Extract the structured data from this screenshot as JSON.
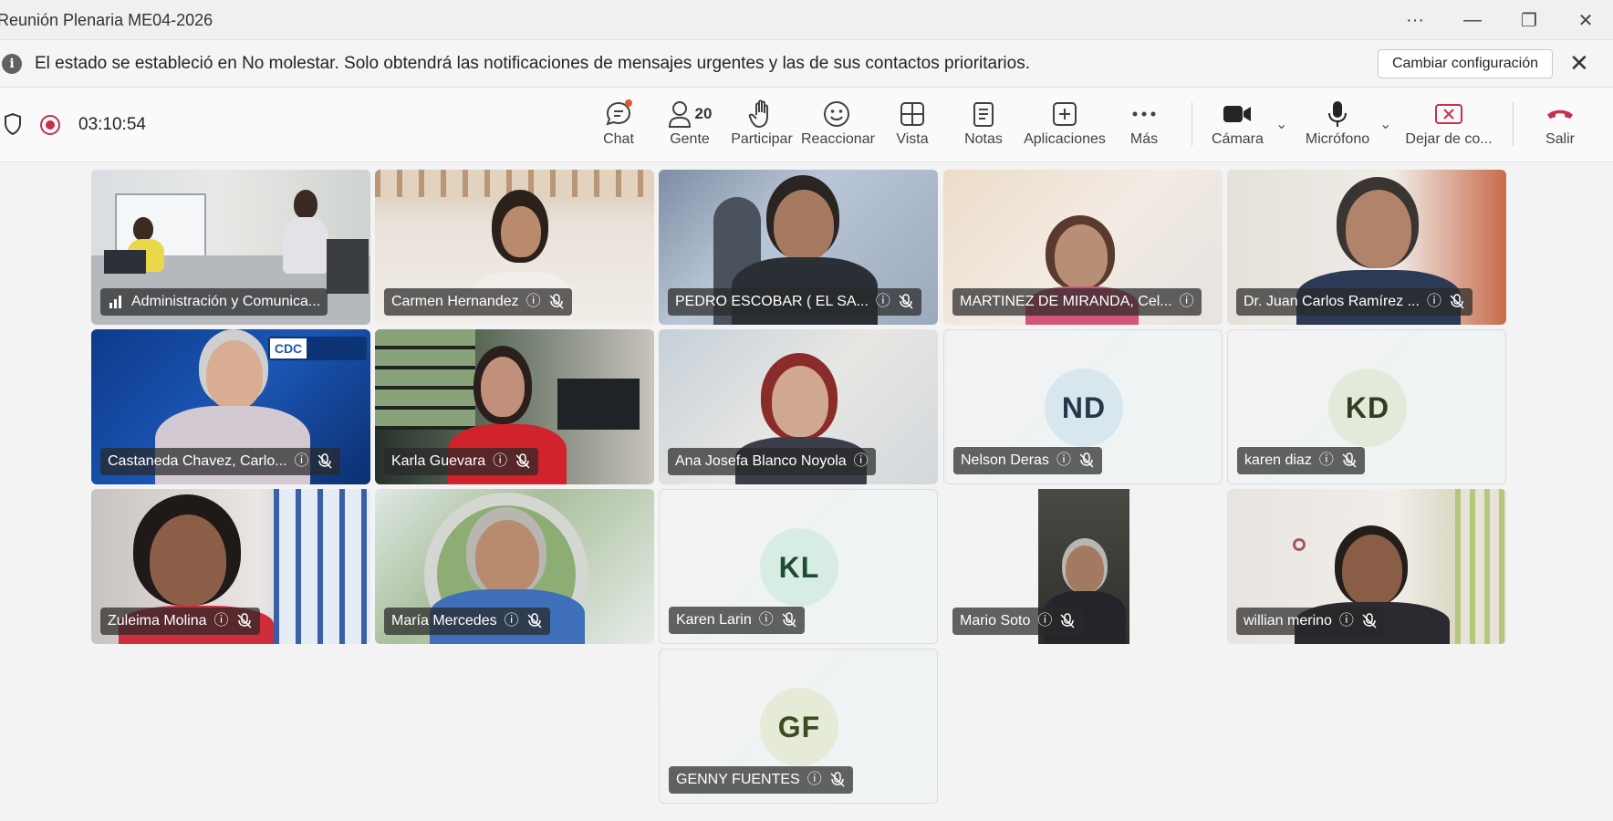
{
  "window": {
    "title": "Reunión Plenaria ME04-2026",
    "more_label": "···",
    "minimize_label": "—",
    "restore_label": "❐",
    "close_label": "✕"
  },
  "notification": {
    "message": "El estado se estableció en No molestar. Solo obtendrá las notificaciones de mensajes urgentes y las de sus contactos prioritarios.",
    "button_label": "Cambiar configuración",
    "close_label": "✕",
    "info_glyph": "i"
  },
  "toolbar": {
    "timer": "03:10:54",
    "buttons": [
      {
        "label": "Chat",
        "icon": "chat-icon"
      },
      {
        "label": "Gente",
        "icon": "people-icon",
        "count": "20"
      },
      {
        "label": "Participar",
        "icon": "raise-hand-icon"
      },
      {
        "label": "Reaccionar",
        "icon": "smile-icon"
      },
      {
        "label": "Vista",
        "icon": "grid-icon"
      },
      {
        "label": "Notas",
        "icon": "notes-icon"
      },
      {
        "label": "Aplicaciones",
        "icon": "add-app-icon"
      },
      {
        "label": "Más",
        "icon": "more-icon"
      },
      {
        "label": "Cámara",
        "icon": "camera-icon"
      },
      {
        "label": "Micrófono",
        "icon": "microphone-icon"
      },
      {
        "label": "Dejar de co...",
        "icon": "stop-share-icon"
      },
      {
        "label": "Salir",
        "icon": "hang-up-icon"
      }
    ],
    "colors": {
      "leave": "#c4314b",
      "record": "#c4314b",
      "notify_dot": "#e0582f"
    }
  },
  "participants": [
    {
      "name": "Administración y Comunica...",
      "kind": "video",
      "status": "signal"
    },
    {
      "name": "Carmen Hernandez",
      "kind": "video",
      "status": "unknown"
    },
    {
      "name": "PEDRO ESCOBAR ( EL SA...",
      "kind": "video",
      "status": "unknown"
    },
    {
      "name": "MARTINEZ DE MIRANDA, Cel...",
      "kind": "video",
      "status": "unknown"
    },
    {
      "name": "Dr. Juan Carlos Ramírez ...",
      "kind": "video",
      "status": "unknown"
    },
    {
      "name": "Castaneda Chavez, Carlo...",
      "kind": "video",
      "status": "unknown",
      "badge": "CDC"
    },
    {
      "name": "Karla Guevara",
      "kind": "video",
      "status": "unknown"
    },
    {
      "name": "Ana Josefa Blanco Noyola",
      "kind": "video",
      "status": "unknown"
    },
    {
      "name": "Nelson Deras",
      "kind": "avatar",
      "initials": "ND"
    },
    {
      "name": "karen diaz",
      "kind": "avatar",
      "initials": "KD"
    },
    {
      "name": "Zuleima Molina",
      "kind": "video",
      "status": "unknown"
    },
    {
      "name": "María Mercedes",
      "kind": "video",
      "status": "unknown"
    },
    {
      "name": "Karen Larin",
      "kind": "avatar",
      "initials": "KL"
    },
    {
      "name": "Mario Soto",
      "kind": "video",
      "status": "unknown"
    },
    {
      "name": "willian merino",
      "kind": "video",
      "status": "unknown"
    },
    {
      "name": "GENNY FUENTES",
      "kind": "avatar",
      "initials": "GF"
    }
  ]
}
